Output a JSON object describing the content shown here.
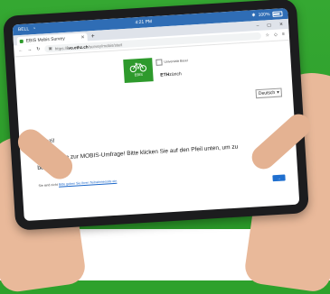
{
  "status_bar": {
    "carrier": "BELL",
    "time": "4:21 PM",
    "battery": "100%"
  },
  "browser": {
    "tab_title": "EBIS Mobis Survey",
    "new_tab": "+",
    "url_prefix": "https://",
    "url_domain": "ivo.ethz.ch",
    "url_rest": "/survey/mobis/start",
    "window_controls": [
      "–",
      "▢",
      "✕"
    ]
  },
  "page": {
    "logo_text": "EBIS",
    "uni_name": "Universität Basel",
    "eth_bold": "ETH",
    "eth_light": "zürich",
    "language": "Deutsch",
    "greeting": "Grüezi!",
    "welcome": "Willkommen zur MOBIS-Umfrage! Bitte klicken Sie auf den Pfeil unten, um zu beginnen.",
    "note_prefix": "Sie sind nicht",
    "note_link": "Bitte geben Sie Ihren Teilnahmecode ein",
    "next_label": "→"
  },
  "colors": {
    "accent_green": "#2e9a2c",
    "status_blue": "#2f6db5",
    "button_blue": "#1f6fcf"
  }
}
